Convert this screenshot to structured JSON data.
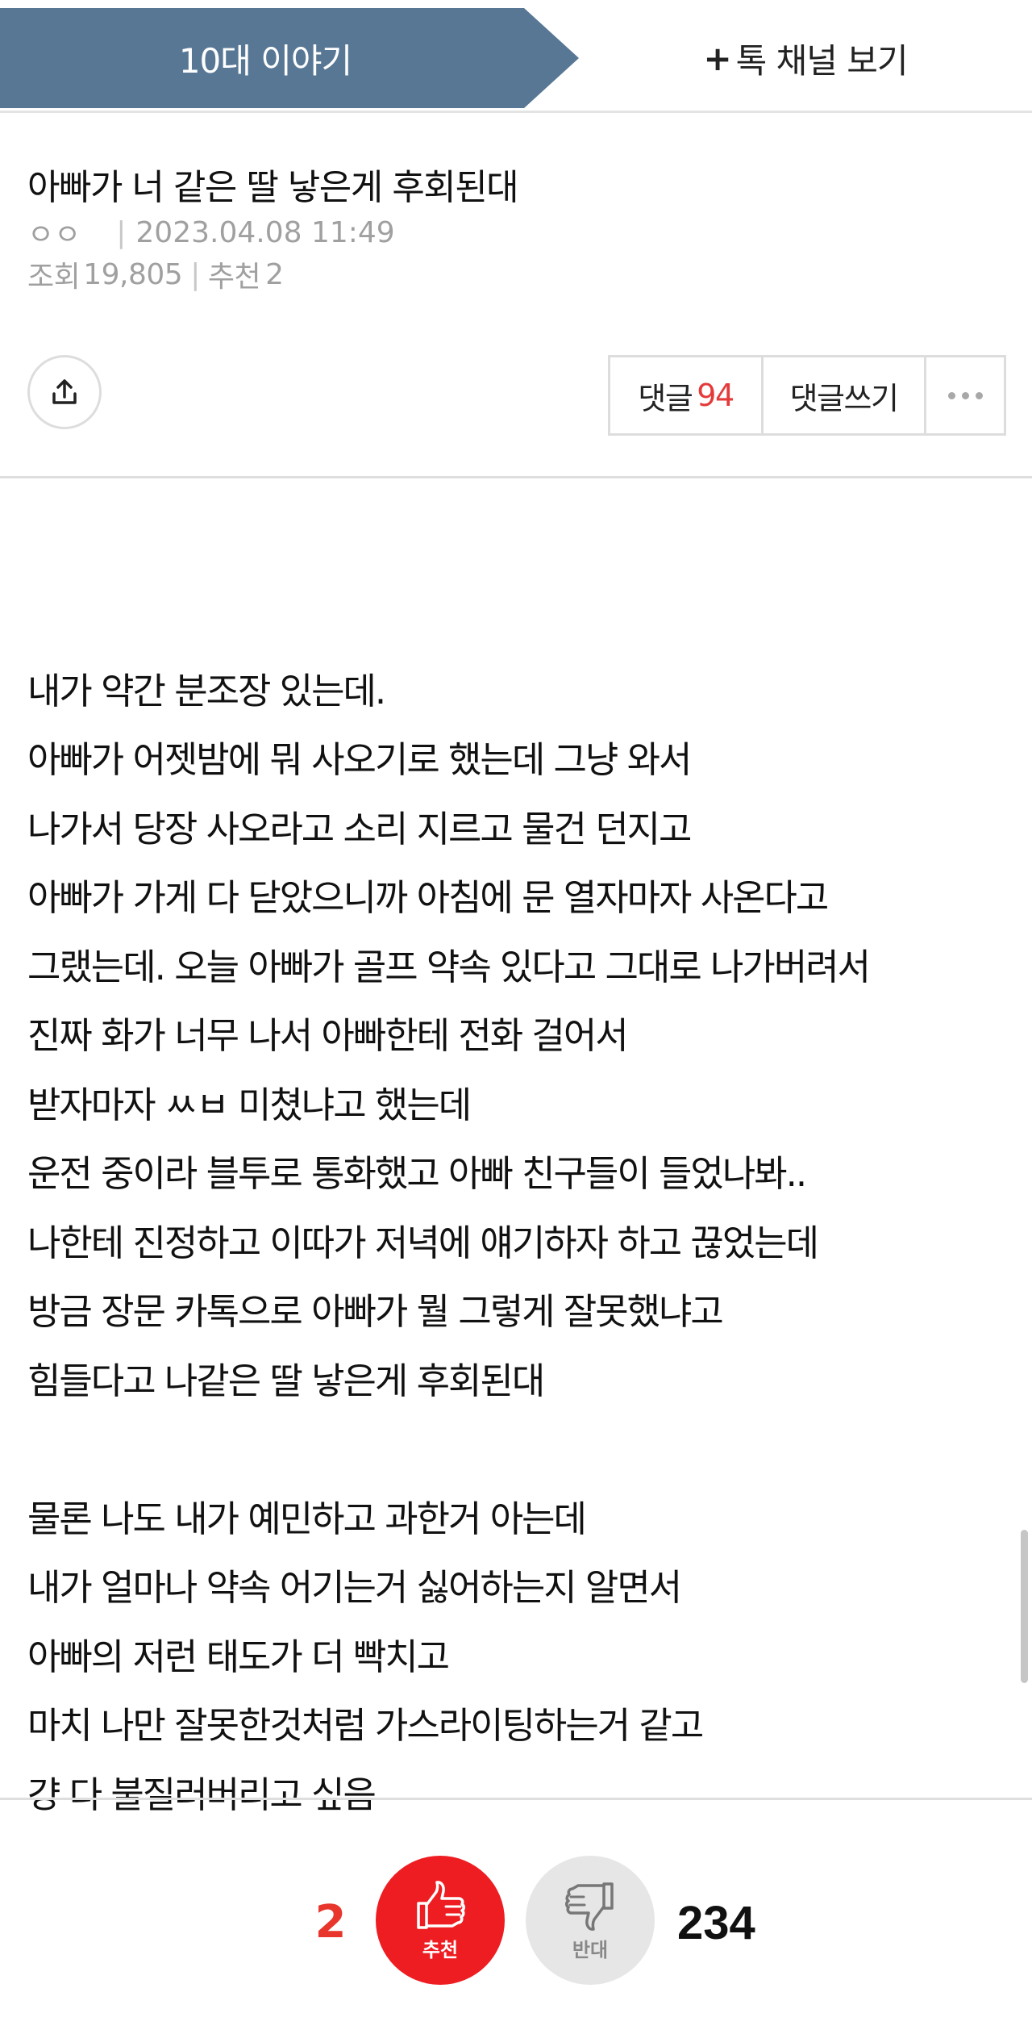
{
  "header": {
    "active_tab_label": "10대 이야기",
    "channel_plus": "+",
    "channel_label": "톡 채널 보기"
  },
  "post": {
    "title": "아빠가 너 같은 딸 낳은게 후회된대",
    "author": "ㅇㅇ",
    "meta_separator": "|",
    "datetime": "2023.04.08 11:49",
    "views_label": "조회",
    "views": "19,805",
    "recommend_label": "추천",
    "recommend_count": "2"
  },
  "actions": {
    "comments_label": "댓글",
    "comments_count": "94",
    "write_comment_label": "댓글쓰기"
  },
  "content": {
    "lines": [
      "",
      "내가 약간 분조장 있는데.",
      "아빠가 어젯밤에 뭐 사오기로 했는데 그냥 와서",
      "나가서 당장 사오라고 소리 지르고 물건 던지고",
      "아빠가 가게 다 닫았으니까 아침에 문 열자마자 사온다고",
      "그랬는데. 오늘 아빠가 골프 약속 있다고 그대로 나가버려서",
      "진짜 화가 너무 나서 아빠한테 전화 걸어서",
      "받자마자 ㅆㅂ 미쳤냐고 했는데",
      "운전 중이라 블투로 통화했고 아빠 친구들이 들었나봐..",
      "나한테 진정하고 이따가 저녁에 얘기하자 하고 끊었는데",
      "방금 장문 카톡으로 아빠가 뭘 그렇게 잘못했냐고",
      "힘들다고 나같은 딸 낳은게 후회된대",
      "",
      "물론 나도 내가 예민하고 과한거 아는데",
      "내가 얼마나 약속 어기는거 싫어하는지 알면서",
      "아빠의 저런 태도가 더 빡치고",
      "마치 나만 잘못한것처럼 가스라이팅하는거 같고",
      "걍 다 불질러버리고 싶음"
    ]
  },
  "vote": {
    "like_count": "2",
    "like_label": "추천",
    "dislike_label": "반대",
    "dislike_count": "234"
  },
  "colors": {
    "tab_bg": "#577795",
    "like_red": "#ee1d22",
    "count_red": "#e8362d",
    "comment_count_red": "#e43a3a"
  },
  "icons": [
    "share-icon",
    "more-dots-icon",
    "thumbs-up-icon",
    "thumbs-down-icon"
  ]
}
